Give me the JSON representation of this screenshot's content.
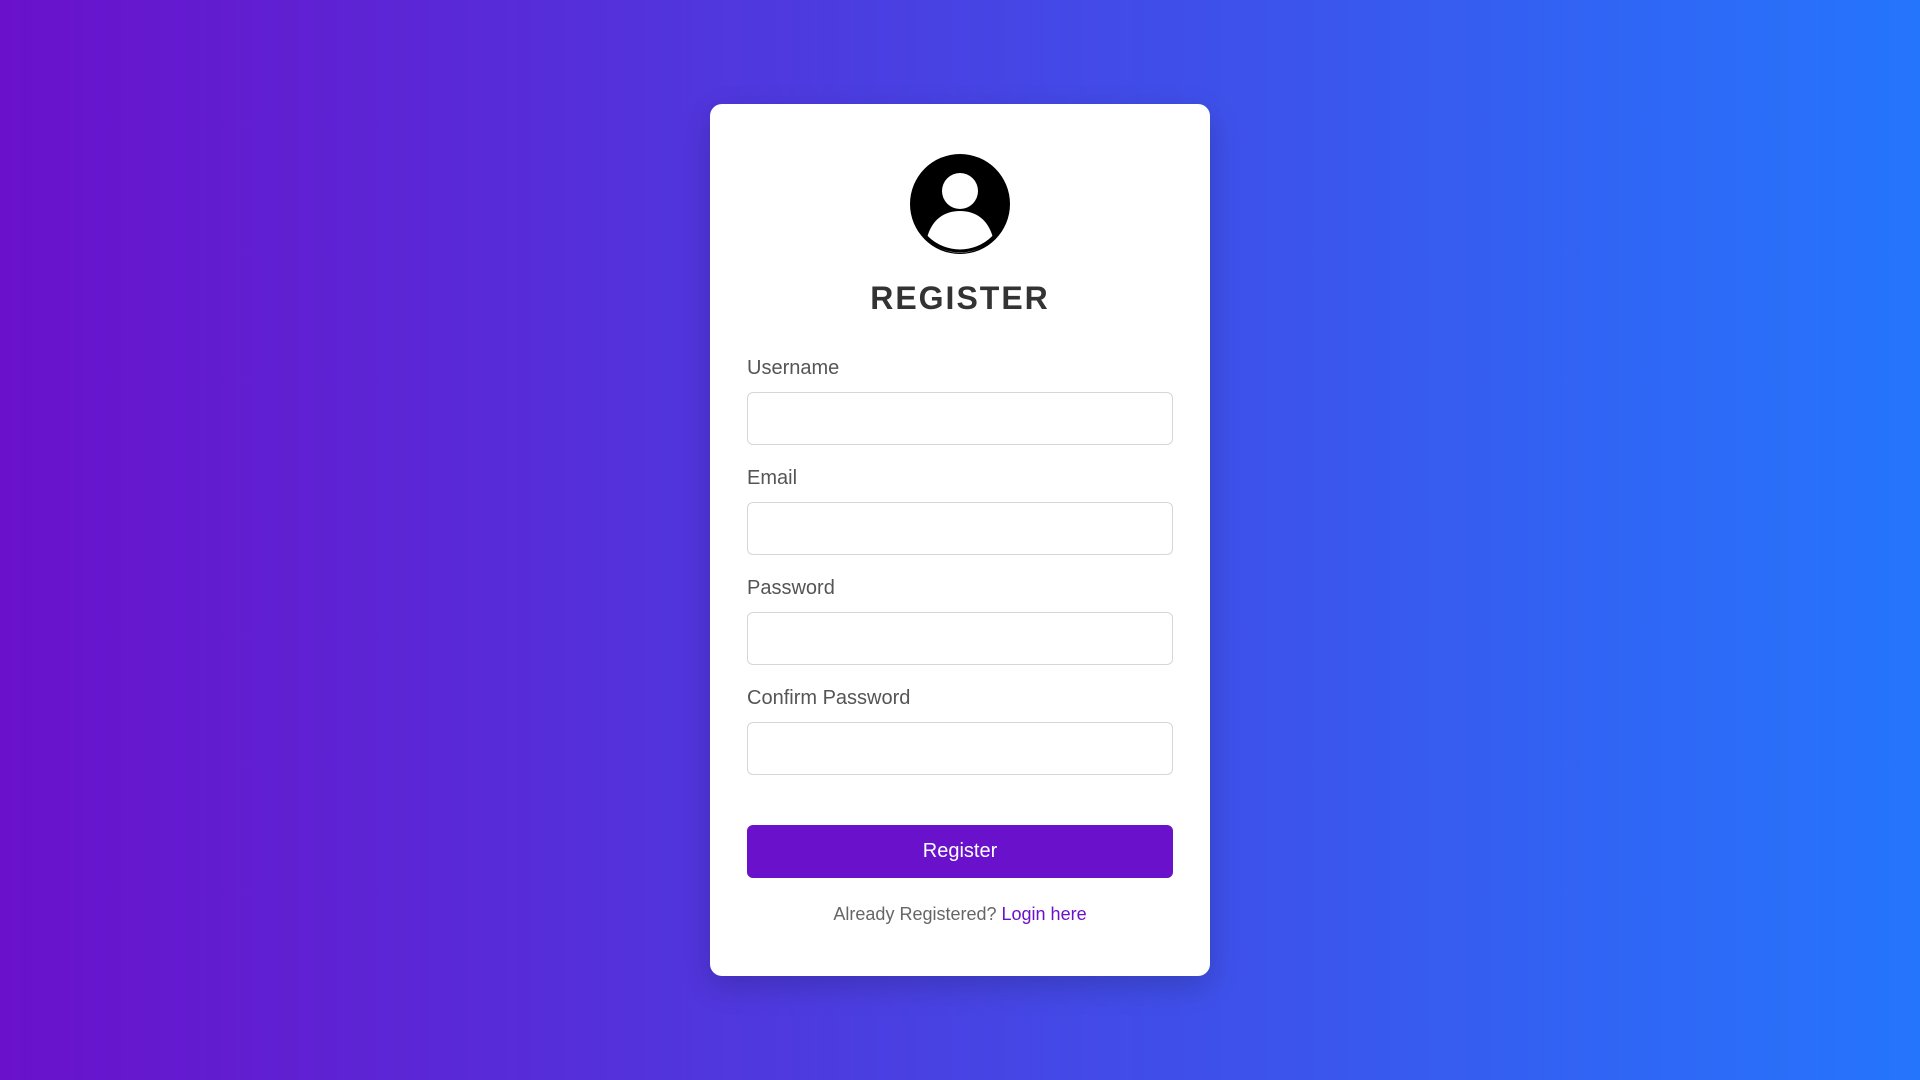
{
  "form": {
    "title": "REGISTER",
    "fields": [
      {
        "label": "Username",
        "value": "",
        "placeholder": ""
      },
      {
        "label": "Email",
        "value": "",
        "placeholder": ""
      },
      {
        "label": "Password",
        "value": "",
        "placeholder": ""
      },
      {
        "label": "Confirm Password",
        "value": "",
        "placeholder": ""
      }
    ],
    "submit_label": "Register",
    "footer_text": "Already Registered?",
    "login_link_label": "Login here"
  },
  "icons": {
    "avatar": "user-circle-icon"
  },
  "colors": {
    "gradient_start": "#6a11cb",
    "gradient_end": "#2575fc",
    "accent": "#6a11cb",
    "card_background": "#ffffff"
  }
}
